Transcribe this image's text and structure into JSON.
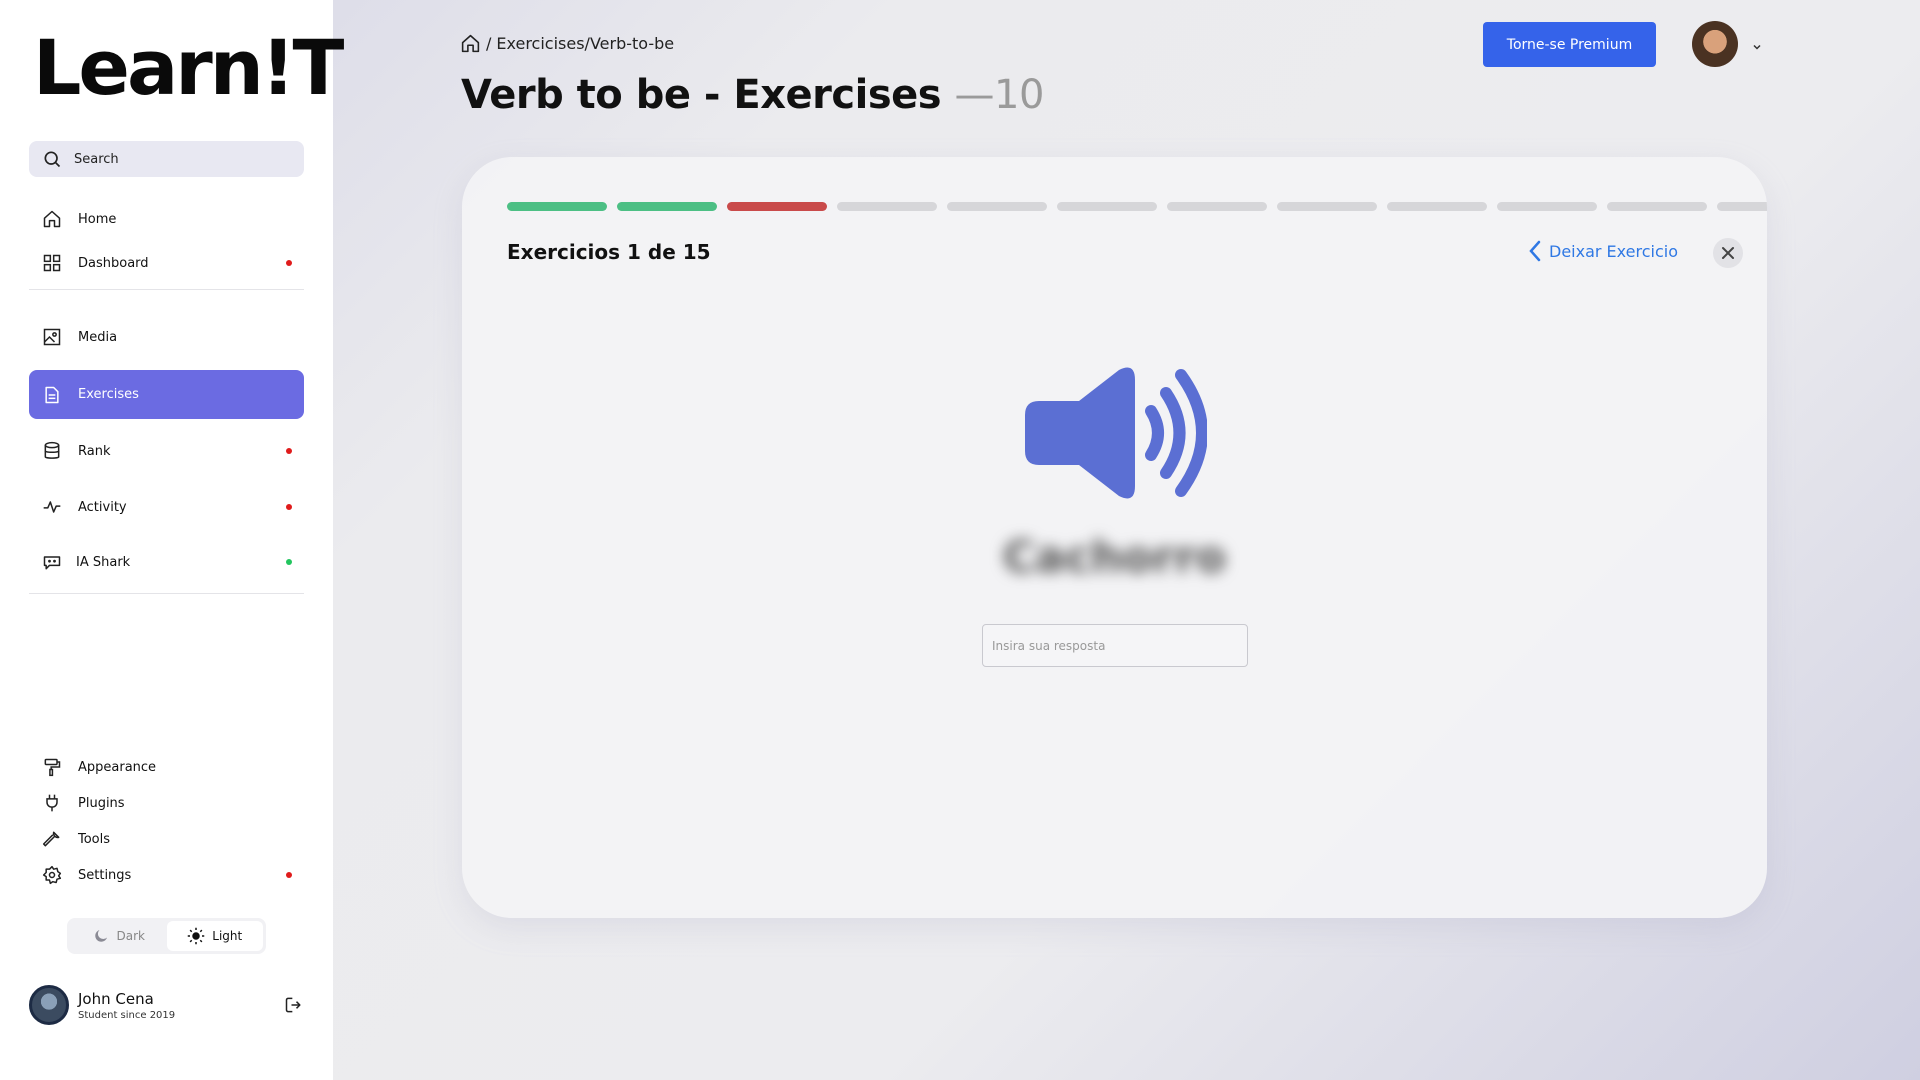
{
  "app": {
    "logo": "Learn!T"
  },
  "sidebar": {
    "search_label": "Search",
    "items": [
      {
        "label": "Home",
        "icon": "home-icon",
        "dot": null
      },
      {
        "label": "Dashboard",
        "icon": "grid-icon",
        "dot": "#e01b1b"
      },
      {
        "label": "Media",
        "icon": "image-icon",
        "dot": null
      },
      {
        "label": "Exercises",
        "icon": "document-icon",
        "dot": null,
        "active": true
      },
      {
        "label": "Rank",
        "icon": "database-icon",
        "dot": "#e01b1b"
      },
      {
        "label": "Activity",
        "icon": "activity-icon",
        "dot": "#e01b1b"
      },
      {
        "label": "IA Shark",
        "icon": "chat-bot-icon",
        "dot": "#22c55e"
      }
    ],
    "bottom_items": [
      {
        "label": "Appearance",
        "icon": "paint-roller-icon",
        "dot": null
      },
      {
        "label": "Plugins",
        "icon": "plug-icon",
        "dot": null
      },
      {
        "label": "Tools",
        "icon": "wrench-icon",
        "dot": null
      },
      {
        "label": "Settings",
        "icon": "gear-icon",
        "dot": "#e01b1b"
      }
    ],
    "theme": {
      "dark_label": "Dark",
      "light_label": "Light",
      "selected": "Light"
    },
    "user": {
      "name": "John Cena",
      "subtitle": "Student since 2019"
    }
  },
  "header": {
    "breadcrumb": "Exercicises/Verb-to-be",
    "title": "Verb to be - Exercises",
    "title_count": "—10",
    "premium_label": "Torne-se Premium"
  },
  "exercise": {
    "count_label": "Exercicios 1 de 15",
    "leave_label": "Deixar Exercicio",
    "word": "Cachorro",
    "answer_placeholder": "Insira sua resposta",
    "progress": [
      "correct",
      "correct",
      "wrong",
      "pending",
      "pending",
      "pending",
      "pending",
      "pending",
      "pending",
      "pending",
      "pending",
      "pending"
    ],
    "colors": {
      "correct": "#4cbf84",
      "wrong": "#c94a4a",
      "pending": "#d6d6d9",
      "accent": "#5b6fd3"
    }
  }
}
